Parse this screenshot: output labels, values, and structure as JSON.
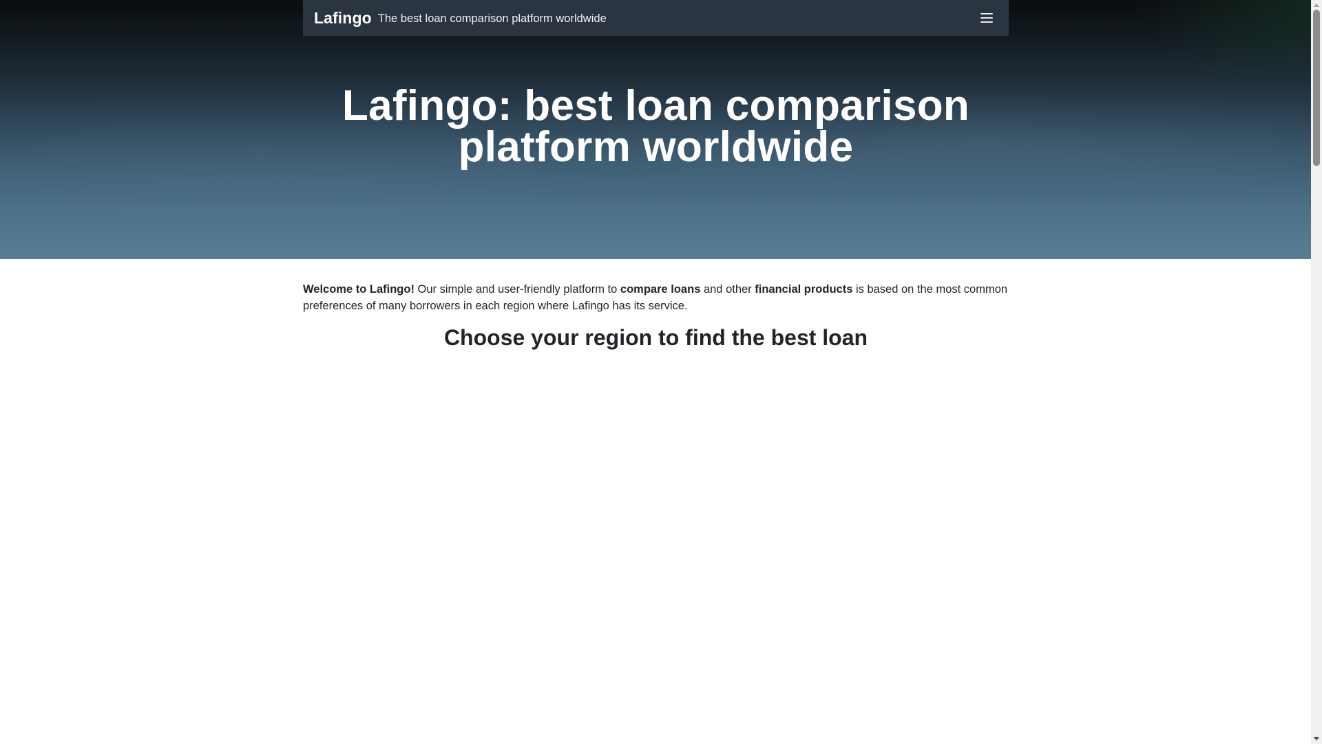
{
  "navbar": {
    "brand": "Lafingo",
    "tagline": "The best loan comparison platform worldwide",
    "menu_icon": "hamburger-menu-icon"
  },
  "hero": {
    "title": "Lafingo: best loan comparison platform worldwide"
  },
  "intro": {
    "welcome": "Welcome to Lafingo!",
    "text_1": " Our simple and user-friendly platform to ",
    "compare_loans": "compare loans",
    "text_2": " and other ",
    "financial_products": "financial products",
    "text_3": " is based on the most common preferences of many borrowers in each region where Lafingo has its service."
  },
  "region_section": {
    "heading": "Choose your region to find the best loan"
  },
  "colors": {
    "navbar_bg": "#2b3441",
    "hero_top": "#0b0d0f",
    "hero_bottom": "#587d94",
    "text": "#212529"
  }
}
